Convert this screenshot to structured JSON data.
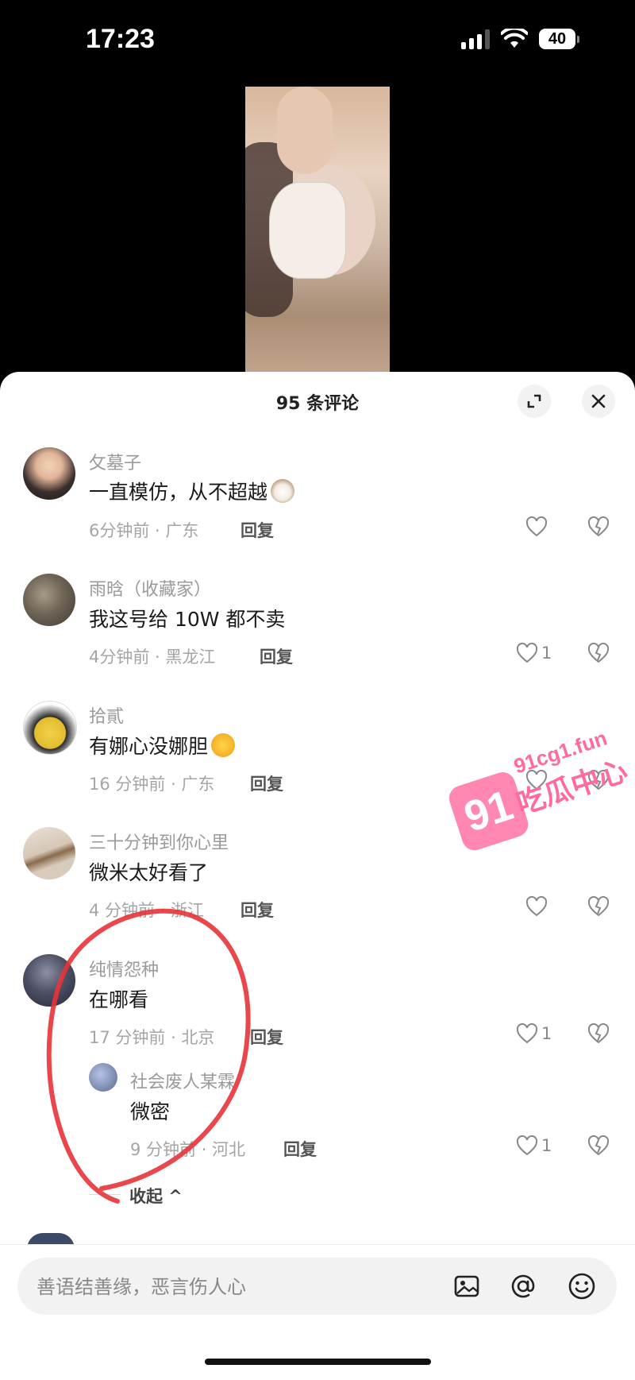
{
  "status_bar": {
    "time": "17:23",
    "battery": "40"
  },
  "sheet": {
    "title": "95 条评论"
  },
  "comments": [
    {
      "user": "攵墓子",
      "text": "一直模仿，从不超越",
      "meta": "6分钟前 · 广东",
      "reply": "回复",
      "likes": ""
    },
    {
      "user": "雨晗（收藏家）",
      "text": "我这号给 10W 都不卖",
      "meta": "4分钟前 · 黑龙江",
      "reply": "回复",
      "likes": "1"
    },
    {
      "user": "拾貳",
      "text": "有娜心没娜胆",
      "meta": "16 分钟前 · 广东",
      "reply": "回复",
      "likes": ""
    },
    {
      "user": "三十分钟到你心里",
      "text": "微米太好看了",
      "meta": "4 分钟前 · 浙江",
      "reply": "回复",
      "likes": ""
    },
    {
      "user": "纯情怨种",
      "text": "在哪看",
      "meta": "17 分钟前 · 北京",
      "reply": "回复",
      "likes": "1"
    }
  ],
  "sub_reply": {
    "user": "社会废人某霖",
    "text": "微密",
    "meta": "9 分钟前 · 河北",
    "reply": "回复",
    "likes": "1"
  },
  "collapse_label": "收起 ^",
  "input": {
    "placeholder": "善语结善缘，恶言伤人心"
  },
  "watermark": {
    "site": "91cg1.fun",
    "logo": "91",
    "name": "吃瓜中心"
  },
  "colors": {
    "accent": "#ff6aa0",
    "annotation": "#e8333a"
  }
}
